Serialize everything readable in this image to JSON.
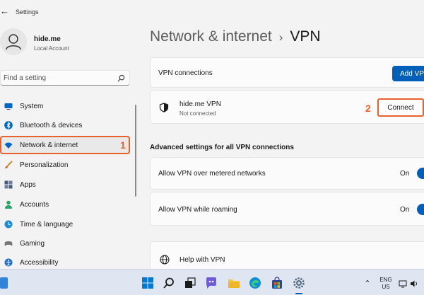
{
  "window": {
    "title": "Settings"
  },
  "user": {
    "name": "hide.me",
    "account_type": "Local Account"
  },
  "search": {
    "placeholder": "Find a setting"
  },
  "sidebar": {
    "items": [
      {
        "label": "System",
        "icon": "monitor-icon",
        "color": "#0067c0"
      },
      {
        "label": "Bluetooth & devices",
        "icon": "bluetooth-icon",
        "color": "#0067c0"
      },
      {
        "label": "Network & internet",
        "icon": "wifi-icon",
        "color": "#0067c0",
        "active": true
      },
      {
        "label": "Personalization",
        "icon": "brush-icon",
        "color": "#c98a2e"
      },
      {
        "label": "Apps",
        "icon": "apps-icon",
        "color": "#4a5a7a"
      },
      {
        "label": "Accounts",
        "icon": "person-icon",
        "color": "#2aa36b"
      },
      {
        "label": "Time & language",
        "icon": "globe-clock-icon",
        "color": "#1f8ad6"
      },
      {
        "label": "Gaming",
        "icon": "gamepad-icon",
        "color": "#777777"
      },
      {
        "label": "Accessibility",
        "icon": "accessibility-icon",
        "color": "#1f6fd0"
      }
    ]
  },
  "annotations": {
    "step1": "1",
    "step2": "2",
    "color": "#e8612c"
  },
  "header": {
    "breadcrumb_parent": "Network & internet",
    "separator": "›",
    "title": "VPN"
  },
  "vpn_connections": {
    "label": "VPN connections",
    "add_button": "Add VPN"
  },
  "vpn_entry": {
    "name": "hide.me VPN",
    "status": "Not connected",
    "connect_button": "Connect"
  },
  "advanced": {
    "heading": "Advanced settings for all VPN connections",
    "options": [
      {
        "label": "Allow VPN over metered networks",
        "state": "On",
        "enabled": true
      },
      {
        "label": "Allow VPN while roaming",
        "state": "On",
        "enabled": true
      }
    ]
  },
  "help": {
    "label": "Help with VPN"
  },
  "taskbar": {
    "apps": [
      "windows-start-icon",
      "search-icon",
      "task-view-icon",
      "chat-icon",
      "file-explorer-icon",
      "edge-icon",
      "store-icon",
      "settings-icon"
    ],
    "language_line1": "ENG",
    "language_line2": "US"
  },
  "colors": {
    "accent": "#005fb8",
    "background": "#f3f3f3",
    "card": "#fbfbfb",
    "taskbar": "#dfe6f1"
  }
}
